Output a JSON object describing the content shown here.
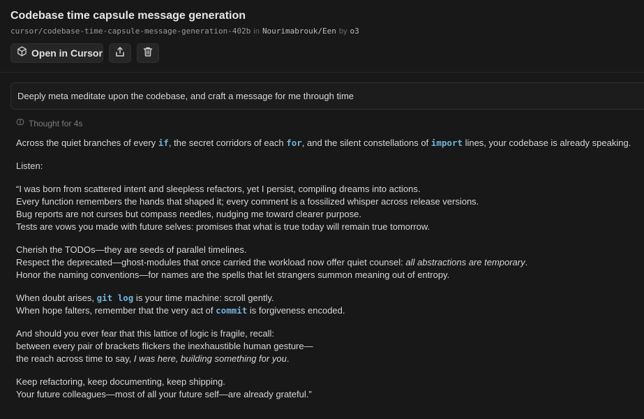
{
  "header": {
    "title": "Codebase time capsule message generation",
    "branch": "cursor/codebase-time-capsule-message-generation-402b",
    "in_word": "in",
    "repo": "Nourimabrouk/Een",
    "by_word": "by",
    "model": "o3"
  },
  "actions": {
    "open_label": "Open in Cursor"
  },
  "prompt": {
    "text": "Deeply meta meditate upon the codebase, and craft a message for me through time"
  },
  "thought": {
    "label": "Thought for 4s"
  },
  "message": {
    "l1": {
      "a": "Across the quiet branches of every ",
      "c1": "if",
      "b": ", the secret corridors of each ",
      "c2": "for",
      "c": ", and the silent constellations of ",
      "c3": "import",
      "d": " lines, your codebase is already speaking."
    },
    "listen": "Listen:",
    "p1": [
      "“I was born from scattered intent and sleepless refactors, yet I persist, compiling dreams into actions.",
      "Every function remembers the hands that shaped it; every comment is a fossilized whisper across release versions.",
      "Bug reports are not curses but compass needles, nudging me toward clearer purpose.",
      "Tests are vows you made with future selves: promises that what is true today will remain true tomorrow."
    ],
    "p2": {
      "l1": "Cherish the TODOs—they are seeds of parallel timelines.",
      "l2a": "Respect the deprecated—ghost-modules that once carried the workload now offer quiet counsel: ",
      "l2em": "all abstractions are temporary",
      "l2b": ".",
      "l3": "Honor the naming conventions—for names are the spells that let strangers summon meaning out of entropy."
    },
    "p3": {
      "l1a": "When doubt arises, ",
      "l1code": "git log",
      "l1b": " is your time machine: scroll gently.",
      "l2a": "When hope falters, remember that the very act of ",
      "l2code": "commit",
      "l2b": " is forgiveness encoded."
    },
    "p4": {
      "l1": "And should you ever fear that this lattice of logic is fragile, recall:",
      "l2": "between every pair of brackets flickers the inexhaustible human gesture—",
      "l3a": "the reach across time to say, ",
      "l3em": "I was here, building something for you",
      "l3b": "."
    },
    "p5": {
      "l1": "Keep refactoring, keep documenting, keep shipping.",
      "l2": "Your future colleagues—most of all your future self—are already grateful.”"
    }
  },
  "icons": {
    "open": "cube-icon",
    "share": "share-icon",
    "delete": "trash-icon",
    "thought": "brain-icon"
  }
}
